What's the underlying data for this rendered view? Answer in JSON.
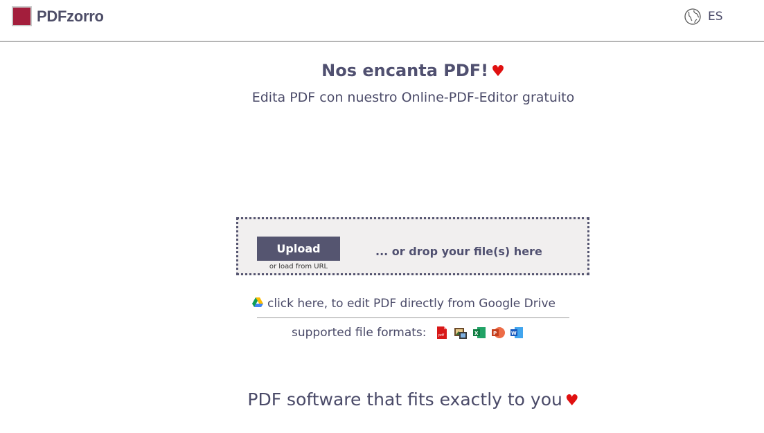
{
  "header": {
    "logo_text": "PDFzorro",
    "language_label": "ES",
    "language_icon": "globe-icon",
    "brand_color": "#a31e3c"
  },
  "hero": {
    "title": "Nos encanta PDF!",
    "heart": "♥",
    "subtitle": "Edita PDF con nuestro Online-PDF-Editor gratuito"
  },
  "upload": {
    "button_label": "Upload",
    "url_link_label": "or load from URL",
    "drop_text": "... or drop your file(s) here"
  },
  "google_drive": {
    "label": "click here, to edit PDF directly from Google Drive",
    "icon": "google-drive-icon"
  },
  "formats": {
    "label": "supported file formats:",
    "icons": [
      "pdf-file-icon",
      "image-file-icon",
      "excel-file-icon",
      "powerpoint-file-icon",
      "word-file-icon"
    ]
  },
  "footer": {
    "title": "PDF software that fits exactly to you",
    "heart": "♥"
  }
}
